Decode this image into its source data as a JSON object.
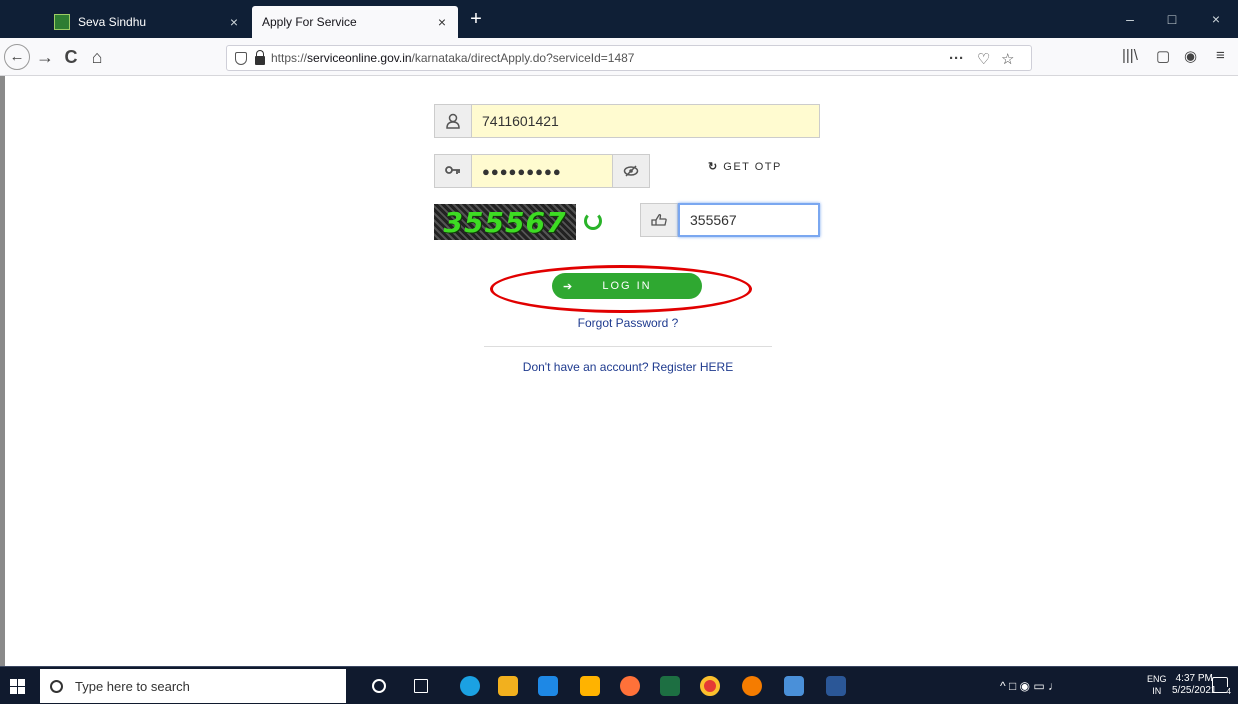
{
  "browser": {
    "tabs": [
      {
        "title": "Seva Sindhu",
        "active": false
      },
      {
        "title": "Apply For Service",
        "active": true
      }
    ],
    "close_glyph": "×",
    "new_tab_glyph": "+",
    "window_controls": {
      "minimize": "–",
      "maximize": "□",
      "close": "×"
    },
    "nav": {
      "back": "←",
      "forward": "→",
      "reload": "C",
      "home": "⌂"
    },
    "url": {
      "prefix": "https://",
      "domain": "serviceonline.gov.in",
      "path": "/karnataka/directApply.do?serviceId=1487"
    },
    "url_actions": {
      "more": "···",
      "pocket": "♡",
      "bookmark": "☆"
    },
    "toolbar_right": {
      "library": "|||\\",
      "reader": "▢",
      "account": "◉",
      "menu": "≡"
    }
  },
  "login_form": {
    "mobile_value": "7411601421",
    "password_mask": "●●●●●●●●●",
    "get_otp_label": "GET OTP",
    "get_otp_icon": "↻",
    "captcha_text": "355567",
    "captcha_input_value": "355567",
    "login_label": "LOG IN",
    "login_icon": "➔",
    "forgot_password": "Forgot Password ?",
    "register": "Don't have an account? Register HERE"
  },
  "icons": {
    "user": "user-icon",
    "key": "key-icon",
    "eye": "eye-slash-icon",
    "hand": "hand-pointer-icon"
  },
  "colors": {
    "login_button": "#2fa831",
    "highlight": "#e10000",
    "link": "#1f3b8f",
    "captcha_text": "#3ddc23",
    "autofill_bg": "#fffbd0"
  },
  "taskbar": {
    "search_placeholder": "Type here to search",
    "lang_line1": "ENG",
    "lang_line2": "IN",
    "time": "4:37 PM",
    "date": "5/25/2021",
    "notifications": "4"
  }
}
